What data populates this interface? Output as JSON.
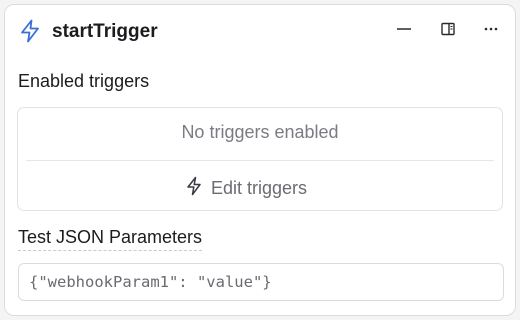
{
  "header": {
    "title": "startTrigger",
    "icons": [
      "bolt-icon",
      "minimize-icon",
      "panel-toggle-icon",
      "more-icon"
    ],
    "accent_color": "#3b6fd8"
  },
  "enabled_triggers": {
    "label": "Enabled triggers",
    "empty_text": "No triggers enabled",
    "edit_label": "Edit triggers"
  },
  "test_params": {
    "label": "Test JSON Parameters",
    "value": "{\"webhookParam1\": \"value\"}"
  }
}
